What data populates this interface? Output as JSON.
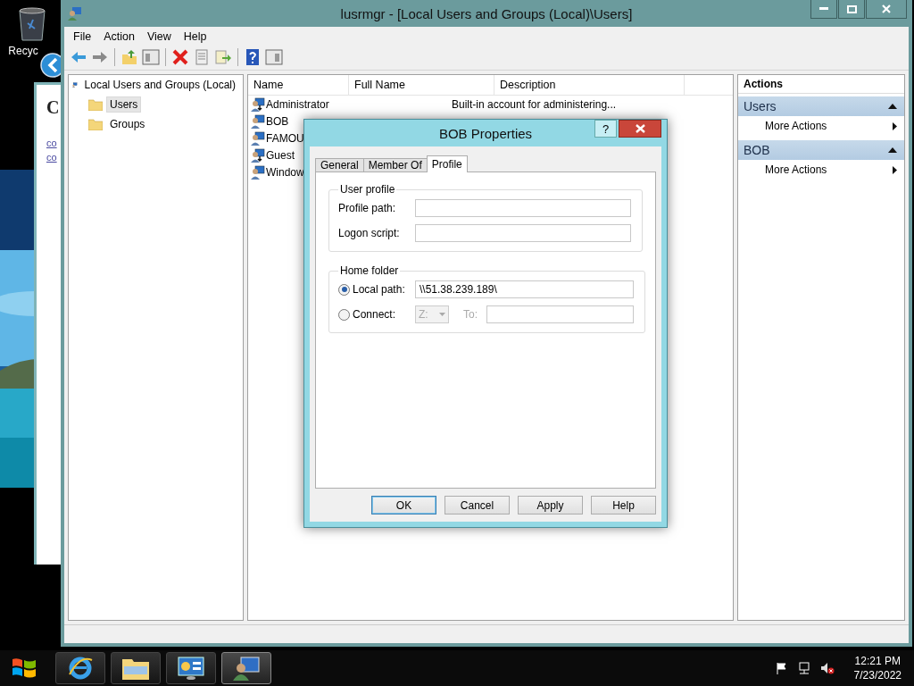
{
  "desktop": {
    "icons": [
      {
        "label": "Recyc"
      }
    ],
    "background_window": {
      "heading": "C",
      "links": [
        "co",
        "co"
      ]
    }
  },
  "window": {
    "title": "lusrmgr - [Local Users and Groups (Local)\\Users]",
    "menu": [
      "File",
      "Action",
      "View",
      "Help"
    ],
    "tree": {
      "label": "Local Users and Groups (Local)",
      "children": [
        {
          "label": "Users",
          "selected": true
        },
        {
          "label": "Groups",
          "selected": false
        }
      ]
    },
    "list": {
      "columns": [
        "Name",
        "Full Name",
        "Description"
      ],
      "rows": [
        {
          "name": "Administrator",
          "description": "Built-in account for administering...",
          "disabled": true
        },
        {
          "name": "BOB",
          "disabled": false
        },
        {
          "name": "FAMOU",
          "disabled": false
        },
        {
          "name": "Guest",
          "disabled": true
        },
        {
          "name": "Window",
          "disabled": false
        }
      ]
    },
    "actions": {
      "title": "Actions",
      "sections": [
        {
          "title": "Users",
          "expanded": true,
          "items": [
            "More Actions"
          ]
        },
        {
          "title": "BOB",
          "expanded": true,
          "items": [
            "More Actions"
          ]
        }
      ]
    }
  },
  "dialog": {
    "title": "BOB Properties",
    "help": "?",
    "tabs": [
      {
        "label": "General",
        "selected": false
      },
      {
        "label": "Member Of",
        "selected": false
      },
      {
        "label": "Profile",
        "selected": true
      }
    ],
    "user_profile": {
      "title": "User profile",
      "fields": [
        {
          "label": "Profile path:"
        },
        {
          "label": "Logon script:"
        }
      ]
    },
    "home_folder": {
      "title": "Home folder",
      "local_path": {
        "label": "Local path:",
        "selected": true,
        "value": "\\\\51.38.239.189\\"
      },
      "connect": {
        "label": "Connect:",
        "selected": false,
        "drive": "Z:",
        "to_label": "To:",
        "disabled": true
      }
    },
    "buttons": [
      {
        "label": "OK",
        "default": true
      },
      {
        "label": "Cancel",
        "default": false
      },
      {
        "label": "Apply",
        "default": false
      },
      {
        "label": "Help",
        "default": false
      }
    ]
  },
  "taskbar": {
    "apps": [
      {
        "kind": "browser",
        "active": false
      },
      {
        "kind": "folders",
        "active": false
      },
      {
        "kind": "server",
        "active": false
      },
      {
        "kind": "users",
        "active": true
      }
    ],
    "time": "12:21 PM",
    "date": "7/23/2022"
  }
}
